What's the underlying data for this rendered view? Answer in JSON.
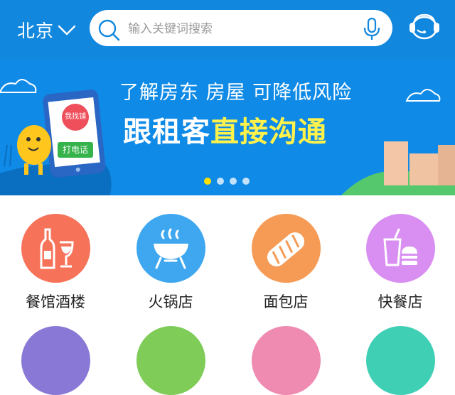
{
  "header": {
    "city": "北京",
    "search_placeholder": "输入关键词搜索",
    "icons": {
      "chevron": "chevron-down-icon",
      "search": "search-icon",
      "mic": "microphone-icon",
      "service": "customer-service-icon"
    },
    "bg_color": "#1187de"
  },
  "banner": {
    "line1": "了解房东 房屋 可降低风险",
    "line2_prefix": "跟租客",
    "line2_highlight": "直接沟通",
    "phone_badge": "我找铺",
    "phone_button": "打电话",
    "slides": 4,
    "active_slide": 1,
    "highlight_color": "#fff24b"
  },
  "categories": [
    {
      "label": "餐馆酒楼",
      "icon": "wine-bottle-glass-icon",
      "color": "#f6735a"
    },
    {
      "label": "火锅店",
      "icon": "hotpot-icon",
      "color": "#3ea7ef"
    },
    {
      "label": "面包店",
      "icon": "bread-icon",
      "color": "#f59b55"
    },
    {
      "label": "快餐店",
      "icon": "fastfood-icon",
      "color": "#d98ef2"
    }
  ],
  "categories_row2_colors": [
    "#8a78d6",
    "#7fcc58",
    "#ef8ab1",
    "#3fcfb4"
  ]
}
